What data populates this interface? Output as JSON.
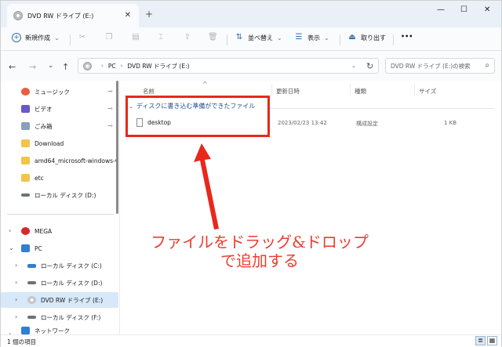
{
  "window": {
    "tab_title": "DVD RW ドライブ (E:)",
    "tab_close": "✕",
    "new_tab": "+",
    "minimize": "—",
    "maximize": "☐",
    "close": "✕"
  },
  "toolbar": {
    "new_label": "新規作成",
    "new_chevron": "⌄",
    "sort_label": "並べ替え",
    "view_label": "表示",
    "eject_label": "取り出す",
    "more": "•••"
  },
  "address": {
    "back": "←",
    "forward": "→",
    "recent": "⌄",
    "up": "↑",
    "segments": [
      "PC",
      "DVD RW ドライブ (E:)"
    ],
    "refresh": "↻",
    "search_placeholder": "DVD RW ドライブ (E:)の検索",
    "search_icon": "search-icon"
  },
  "sidebar": {
    "quick_access": [
      {
        "label": "ミュージック",
        "icon": "music-icon",
        "color": "#e5613f",
        "pinned": true
      },
      {
        "label": "ビデオ",
        "icon": "video-icon",
        "color": "#6b58c9",
        "pinned": true
      },
      {
        "label": "ごみ箱",
        "icon": "recycle-bin-icon",
        "color": "#8aa1b8",
        "pinned": true
      },
      {
        "label": "Download",
        "icon": "folder-icon",
        "color": "#f3c44a",
        "pinned": false
      },
      {
        "label": "amd64_microsoft-windows-v",
        "icon": "folder-icon",
        "color": "#f3c44a",
        "pinned": false
      },
      {
        "label": "etc",
        "icon": "folder-icon",
        "color": "#f3c44a",
        "pinned": false
      },
      {
        "label": "ローカル ディスク (D:)",
        "icon": "drive-icon",
        "color": "#6e7278",
        "pinned": false
      }
    ],
    "tree": [
      {
        "label": "MEGA",
        "icon": "mega-icon",
        "color": "#d9272e",
        "expanded": false
      },
      {
        "label": "PC",
        "icon": "pc-icon",
        "color": "#2f7fd2",
        "expanded": true
      },
      {
        "label": "ローカル ディスク (C:)",
        "icon": "drive-c-icon",
        "color": "#2f7fd2",
        "expanded": false
      },
      {
        "label": "ローカル ディスク (D:)",
        "icon": "drive-icon",
        "color": "#6e7278",
        "expanded": false
      },
      {
        "label": "DVD RW ドライブ (E:)",
        "icon": "dvd-drive-icon",
        "color": "#b8bcc2",
        "expanded": false,
        "selected": true
      },
      {
        "label": "ローカル ディスク (F:)",
        "icon": "drive-icon",
        "color": "#6e7278",
        "expanded": false
      },
      {
        "label": "ネットワーク",
        "icon": "network-icon",
        "color": "#2f7fd2",
        "expanded": false
      }
    ],
    "pin_glyph": "📌",
    "chevron_collapsed": "›",
    "chevron_expanded": "⌄"
  },
  "content": {
    "columns": [
      "名前",
      "更新日時",
      "種類",
      "サイズ"
    ],
    "sort_caret": "^",
    "group_label": "ディスクに書き込む準備ができたファイル",
    "group_chevron": "⌄",
    "files": [
      {
        "name": "desktop",
        "modified": "2023/02/23 13:42",
        "type": "構成設定",
        "size": "1 KB"
      }
    ]
  },
  "annotation": {
    "callout_line1": "ファイルをドラッグ&ドロップ",
    "callout_line2": "で追加する",
    "color": "#e8281c"
  },
  "status": {
    "item_count": "1 個の項目"
  }
}
